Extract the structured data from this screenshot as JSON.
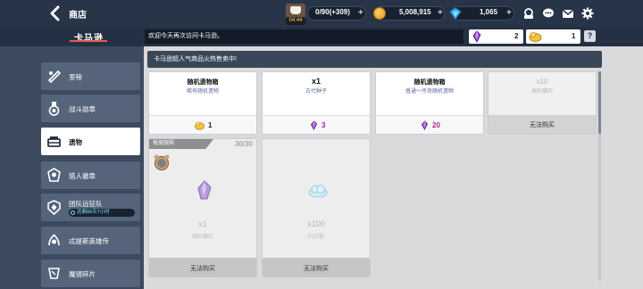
{
  "topbar": {
    "title": "商店",
    "energy_time": "04:44",
    "energy": "0/90(+309)",
    "gold": "5,008,915",
    "gems": "1,065",
    "plus": "+"
  },
  "subheader": {
    "logo": "卡马逊",
    "welcome": "欢迎今天再次访问卡马逊。",
    "ticket_purple": "2",
    "ticket_gold": "1",
    "help": "?"
  },
  "sidebar": {
    "items": [
      {
        "label": "里程",
        "icon": "mileage-icon"
      },
      {
        "label": "战斗勋章",
        "icon": "medal-icon"
      },
      {
        "label": "遗物",
        "icon": "relic-icon",
        "active": true
      },
      {
        "label": "猎人徽章",
        "icon": "badge-icon"
      },
      {
        "label": "团队远征队",
        "icon": "expedition-icon",
        "sub": "还剩88天7小时"
      },
      {
        "label": "忒提斯英雄传",
        "icon": "hero-icon"
      },
      {
        "label": "魔镜碎片",
        "icon": "mirror-icon"
      }
    ]
  },
  "banner": "卡马逊超人气商品火热售卖中!",
  "cards": [
    {
      "title": "随机遗物箱",
      "subtitle": "稀有随机遗物",
      "price": "1",
      "currency": "gold-ticket"
    },
    {
      "title": "x1",
      "subtitle": "古代种子",
      "price": "3",
      "currency": "purple-crystal"
    },
    {
      "title": "随机遗物箱",
      "subtitle": "普通～传奇随机遗物",
      "price": "20",
      "currency": "purple-crystal"
    },
    {
      "title": "x10",
      "subtitle": "高阶魔石",
      "no_buy": "无法购买"
    }
  ],
  "daily": {
    "tag": "每周限购",
    "count": "30/30",
    "items": [
      {
        "qty": "x1",
        "name": "周阶魔石",
        "no_buy": "无法购买",
        "icon": "purple-crystal-icon"
      },
      {
        "qty": "x100",
        "name": "闪光粉",
        "no_buy": "无法购买",
        "icon": "cloud-powder-icon"
      }
    ]
  },
  "colors": {
    "topbar": "#283548",
    "accent_red": "#e65d46",
    "purple_price": "#a0298c",
    "gold_price": "#222222"
  }
}
